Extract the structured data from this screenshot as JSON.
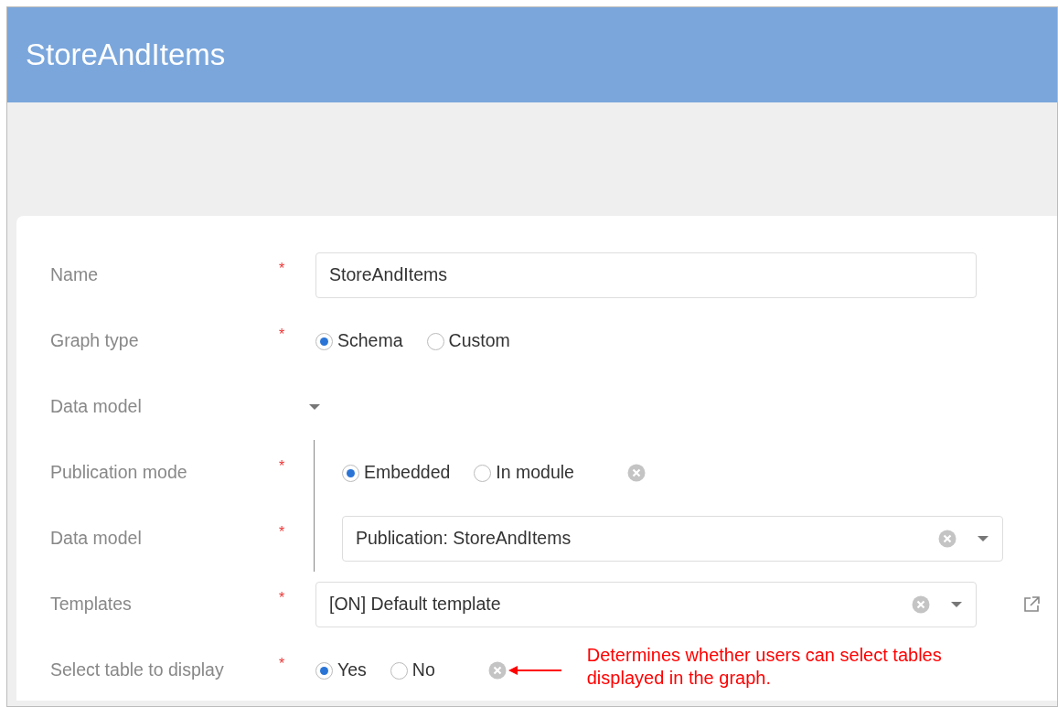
{
  "header": {
    "title": "StoreAndItems"
  },
  "fields": [
    {
      "kind": "text",
      "label": "Name",
      "required_mark": "*",
      "value": "StoreAndItems"
    },
    {
      "kind": "radio",
      "label": "Graph type",
      "required_mark": "*",
      "options": [
        {
          "label": "Schema",
          "selected": true
        },
        {
          "label": "Custom",
          "selected": false
        }
      ]
    },
    {
      "kind": "group",
      "label": "Data model",
      "expanded": true,
      "children": [
        {
          "kind": "radio",
          "label": "Publication mode",
          "required_mark": "*",
          "clear_button": true,
          "options": [
            {
              "label": "Embedded",
              "selected": true
            },
            {
              "label": "In module",
              "selected": false
            }
          ]
        },
        {
          "kind": "select",
          "label": "Data model",
          "required_mark": "*",
          "clear_button": true,
          "value": "Publication: StoreAndItems"
        }
      ]
    },
    {
      "kind": "select",
      "label": "Templates",
      "required_mark": "*",
      "clear_button": true,
      "external_link": true,
      "value": "[ON] Default template"
    },
    {
      "kind": "radio",
      "label": "Select table to display",
      "required_mark": "*",
      "clear_button": true,
      "options": [
        {
          "label": "Yes",
          "selected": true
        },
        {
          "label": "No",
          "selected": false
        }
      ],
      "annotation": "Determines whether users can select tables displayed in the graph."
    }
  ]
}
